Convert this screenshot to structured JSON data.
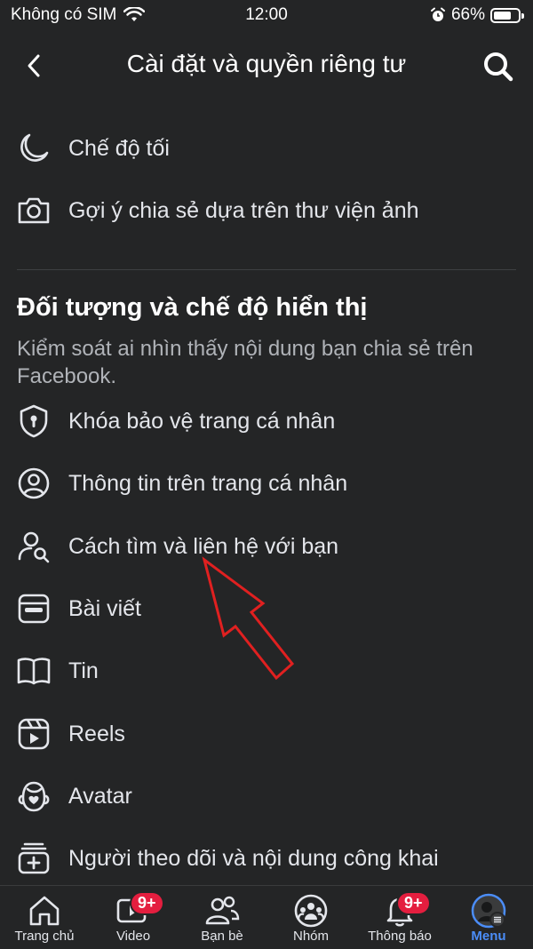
{
  "status": {
    "carrier": "Không có SIM",
    "time": "12:00",
    "battery": "66%"
  },
  "header": {
    "title": "Cài đặt và quyền riêng tư"
  },
  "items_top": [
    {
      "label": "Chế độ tối",
      "icon": "moon-icon"
    },
    {
      "label": "Gợi ý chia sẻ dựa trên thư viện ảnh",
      "icon": "camera-icon"
    }
  ],
  "section": {
    "title": "Đối tượng và chế độ hiển thị",
    "desc": "Kiểm soát ai nhìn thấy nội dung bạn chia sẻ trên Facebook."
  },
  "items": [
    {
      "label": "Khóa bảo vệ trang cá nhân",
      "icon": "shield-lock-icon"
    },
    {
      "label": "Thông tin trên trang cá nhân",
      "icon": "profile-circle-icon"
    },
    {
      "label": "Cách tìm và liên hệ với bạn",
      "icon": "person-search-icon"
    },
    {
      "label": "Bài viết",
      "icon": "post-icon"
    },
    {
      "label": "Tin",
      "icon": "book-icon"
    },
    {
      "label": "Reels",
      "icon": "reels-icon"
    },
    {
      "label": "Avatar",
      "icon": "avatar-icon"
    },
    {
      "label": "Người theo dõi và nội dung công khai",
      "icon": "followers-icon"
    }
  ],
  "tabs": [
    {
      "label": "Trang chủ",
      "icon": "home-icon"
    },
    {
      "label": "Video",
      "icon": "video-icon",
      "badge": "9+"
    },
    {
      "label": "Bạn bè",
      "icon": "friends-icon"
    },
    {
      "label": "Nhóm",
      "icon": "groups-icon"
    },
    {
      "label": "Thông báo",
      "icon": "bell-icon",
      "badge": "9+"
    },
    {
      "label": "Menu",
      "icon": "menu-avatar-icon"
    }
  ],
  "colors": {
    "background": "#242526",
    "accent": "#4b8df8",
    "badge": "#e41e3f",
    "annotation_arrow": "#e02020"
  }
}
